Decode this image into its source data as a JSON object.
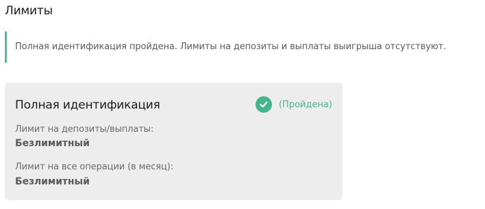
{
  "page": {
    "title": "Лимиты"
  },
  "notice": {
    "text": "Полная идентификация пройдена. Лимиты на депозиты и выплаты выигрыша отсутствуют."
  },
  "card": {
    "title": "Полная идентификация",
    "status_icon": "check-circle-icon",
    "status_text": "(Пройдена)",
    "accent_color": "#45b58d",
    "limits": [
      {
        "label": "Лимит на депозиты/выплаты:",
        "value": "Безлимитный"
      },
      {
        "label": "Лимит на все операции (в месяц):",
        "value": "Безлимитный"
      }
    ]
  }
}
